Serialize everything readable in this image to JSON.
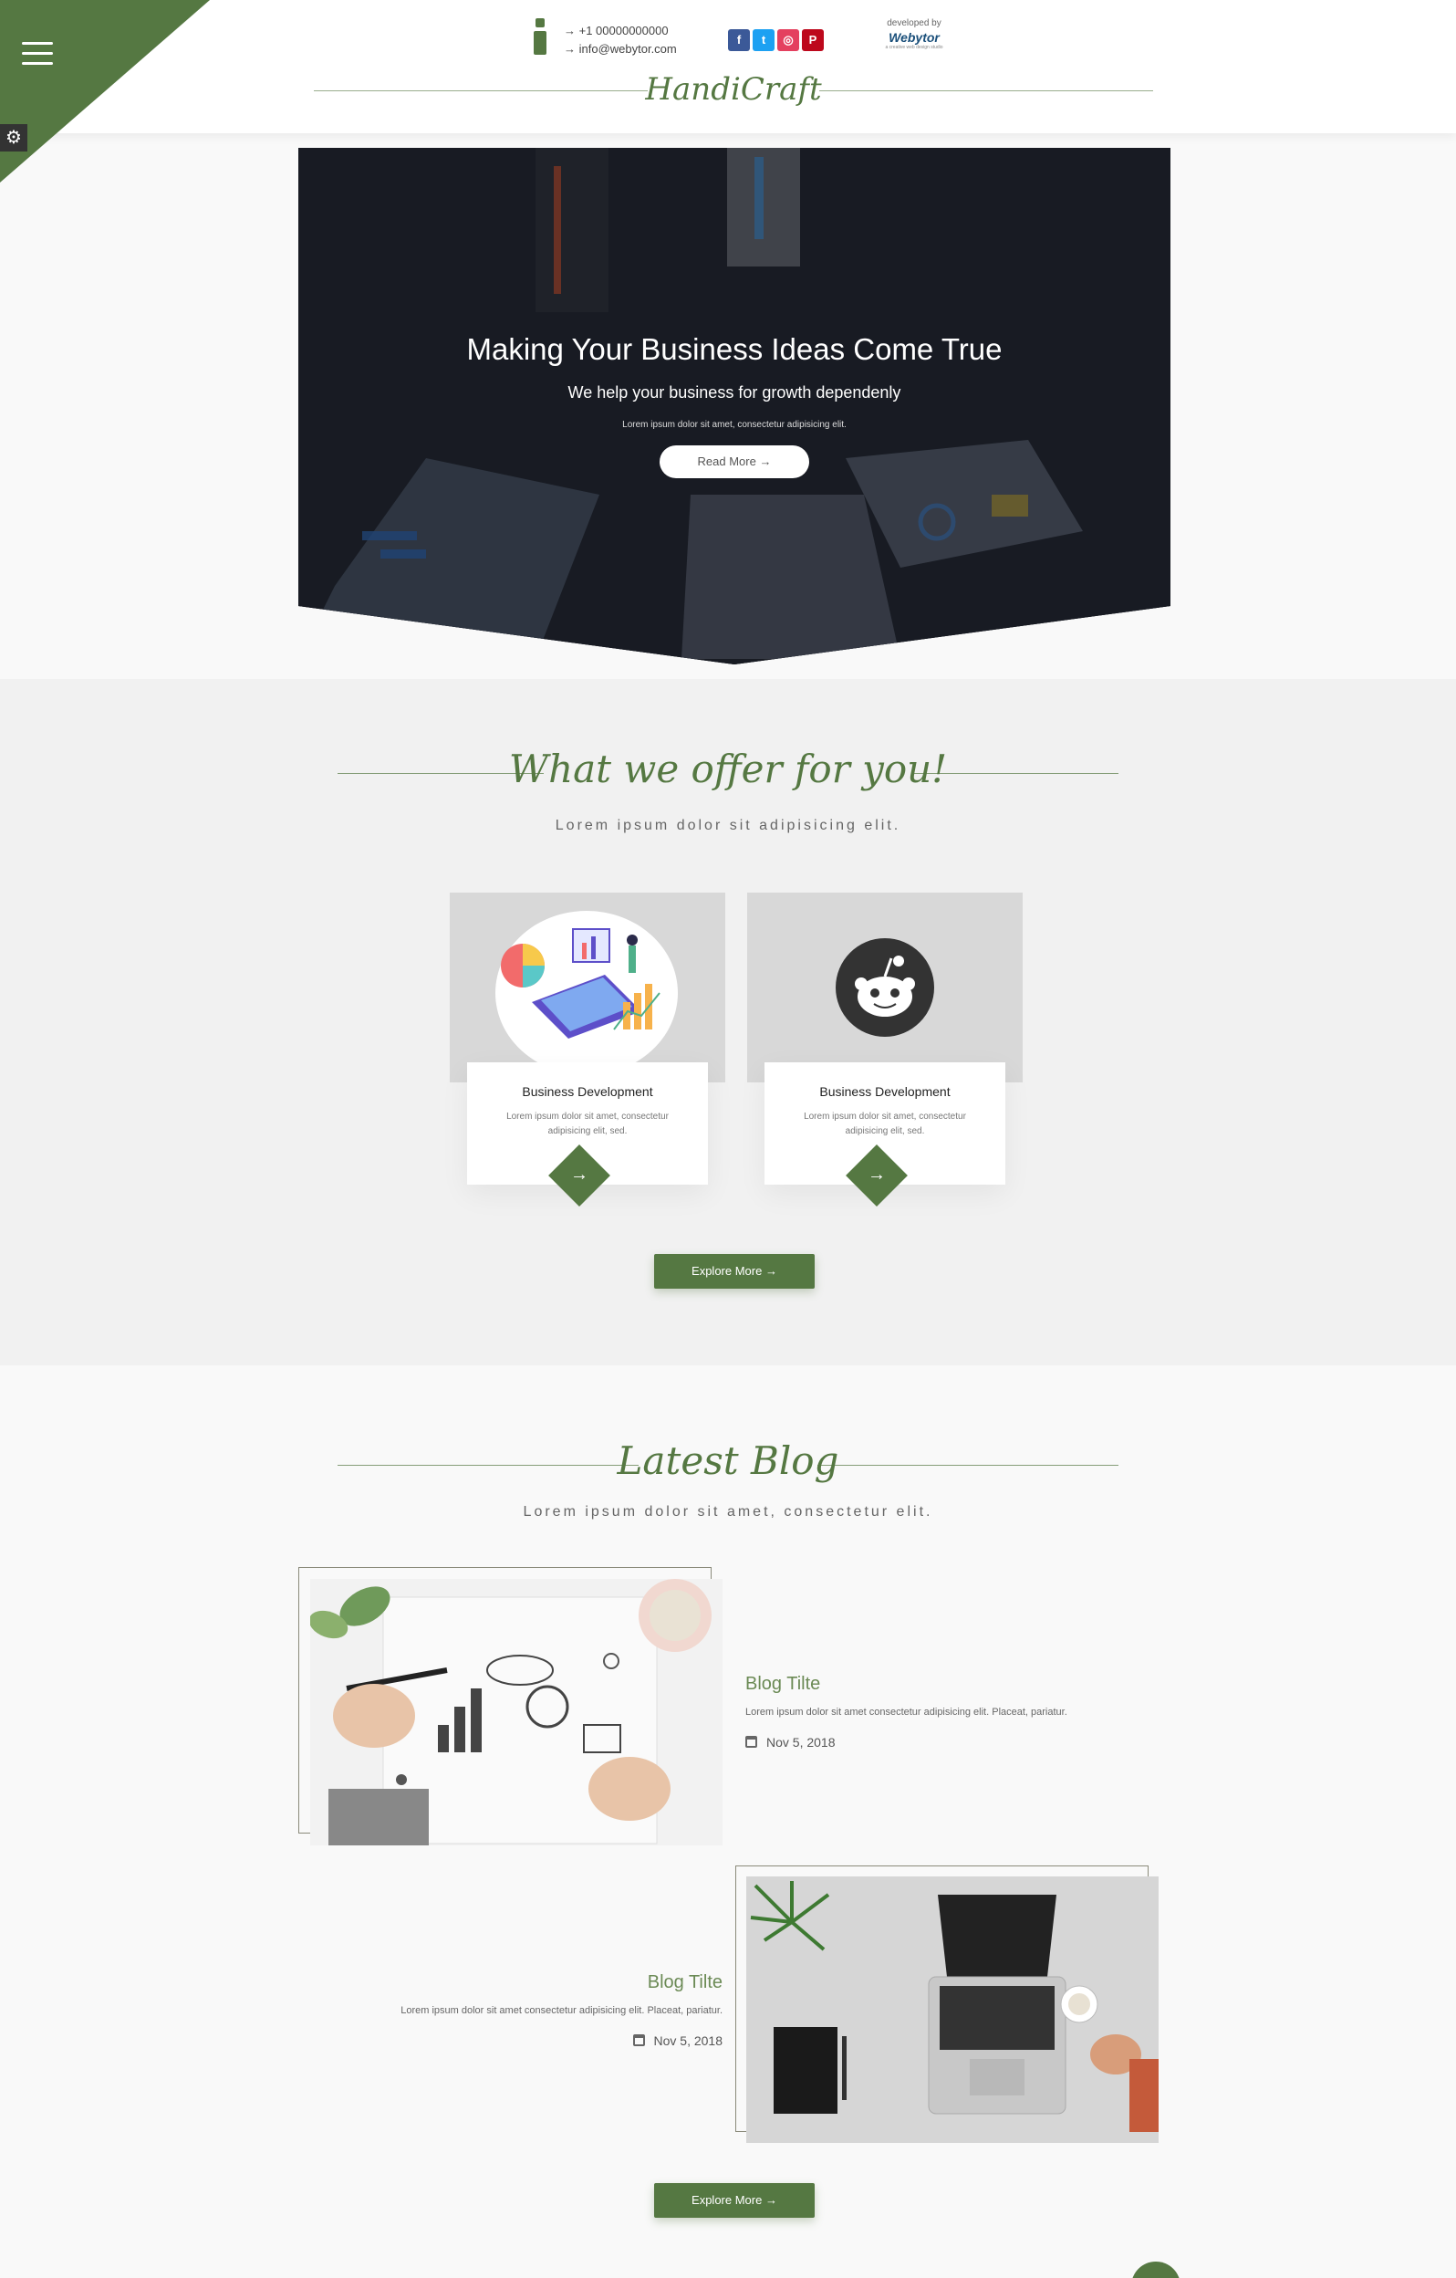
{
  "header": {
    "phone": "→ +1 00000000000",
    "email": "→ info@webytor.com",
    "socials": [
      {
        "label": "f",
        "color": "#3b5998"
      },
      {
        "label": "t",
        "color": "#1da1f2"
      },
      {
        "label": "◎",
        "color": "#e4405f"
      },
      {
        "label": "P",
        "color": "#bd081c"
      }
    ],
    "developed_by": "developed by",
    "dev_logo": "Webytor",
    "dev_sub": "a creative web design studio",
    "brand": "HandiCraft"
  },
  "hero": {
    "title": "Making Your Business Ideas Come True",
    "subtitle": "We help your business for growth dependenly",
    "small": "Lorem ipsum dolor sit amet, consectetur adipisicing elit.",
    "button": "Read More →"
  },
  "offer": {
    "title": "What we offer for you!",
    "subtitle": "Lorem ipsum dolor sit adipisicing elit.",
    "cards": [
      {
        "title": "Business Development",
        "text": "Lorem ipsum dolor sit amet, consectetur adipisicing elit, sed.",
        "arrow": "→"
      },
      {
        "title": "Business Development",
        "text": "Lorem ipsum dolor sit amet, consectetur adipisicing elit, sed.",
        "arrow": "→"
      }
    ],
    "button": "Explore More  →"
  },
  "blog": {
    "title": "Latest Blog",
    "subtitle": "Lorem ipsum dolor sit amet, consectetur elit.",
    "posts": [
      {
        "title": "Blog Tilte",
        "text": "Lorem ipsum dolor sit amet consectetur adipisicing elit. Placeat, pariatur.",
        "date": "Nov 5, 2018"
      },
      {
        "title": "Blog Tilte",
        "text": "Lorem ipsum dolor sit amet consectetur adipisicing elit. Placeat, pariatur.",
        "date": "Nov 5, 2018"
      }
    ],
    "button": "Explore More  →"
  },
  "colors": {
    "accent": "#557842",
    "section_bg": "#f1f1f1",
    "page_bg": "#f9f9f9"
  }
}
